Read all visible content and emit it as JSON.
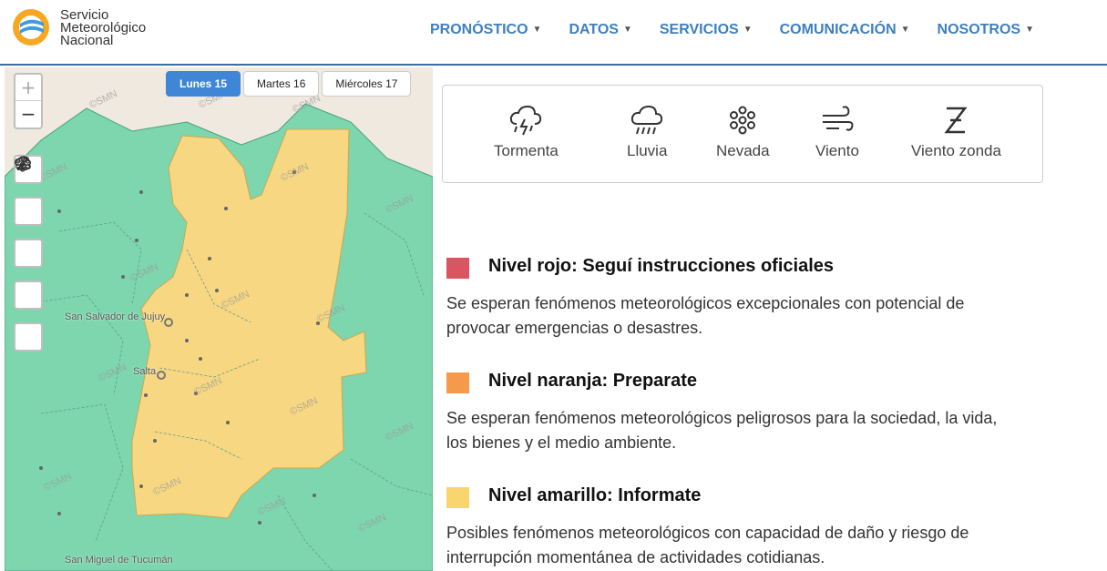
{
  "brand": {
    "line1": "Servicio",
    "line2": "Meteorológico",
    "line3": "Nacional"
  },
  "nav": [
    {
      "label": "PRONÓSTICO"
    },
    {
      "label": "DATOS"
    },
    {
      "label": "SERVICIOS"
    },
    {
      "label": "COMUNICACIÓN"
    },
    {
      "label": "NOSOTROS"
    }
  ],
  "map": {
    "zoom_in": "+",
    "zoom_out": "−",
    "days": [
      {
        "label": "Lunes 15",
        "active": true
      },
      {
        "label": "Martes 16",
        "active": false
      },
      {
        "label": "Miércoles 17",
        "active": false
      }
    ],
    "places": {
      "jujuy": "San Salvador de Jujuy",
      "salta": "Salta",
      "tucuman": "San Miguel de Tucumán"
    },
    "tools": [
      "storm-icon",
      "rain-icon",
      "snow-icon",
      "wind-icon",
      "zonda-icon"
    ],
    "colors": {
      "green": "#7dd6ae",
      "yellow": "#f7d781",
      "land": "#efe9df"
    }
  },
  "legend": [
    {
      "label": "Tormenta",
      "icon": "storm-icon"
    },
    {
      "label": "Lluvia",
      "icon": "rain-icon"
    },
    {
      "label": "Nevada",
      "icon": "snow-icon"
    },
    {
      "label": "Viento",
      "icon": "wind-icon"
    },
    {
      "label": "Viento zonda",
      "icon": "zonda-icon"
    }
  ],
  "levels": [
    {
      "title": "Nivel rojo: Seguí instrucciones oficiales",
      "color": "#d95560",
      "desc": "Se esperan fenómenos meteorológicos excepcionales con potencial de provocar emergencias o desastres."
    },
    {
      "title": "Nivel naranja: Preparate",
      "color": "#f49a4a",
      "desc": "Se esperan fenómenos meteorológicos peligrosos para la sociedad, la vida, los bienes y el medio ambiente."
    },
    {
      "title": "Nivel amarillo: Informate",
      "color": "#f8d56d",
      "desc": "Posibles fenómenos meteorológicos con capacidad de daño y riesgo de interrupción momentánea de actividades cotidianas."
    }
  ]
}
